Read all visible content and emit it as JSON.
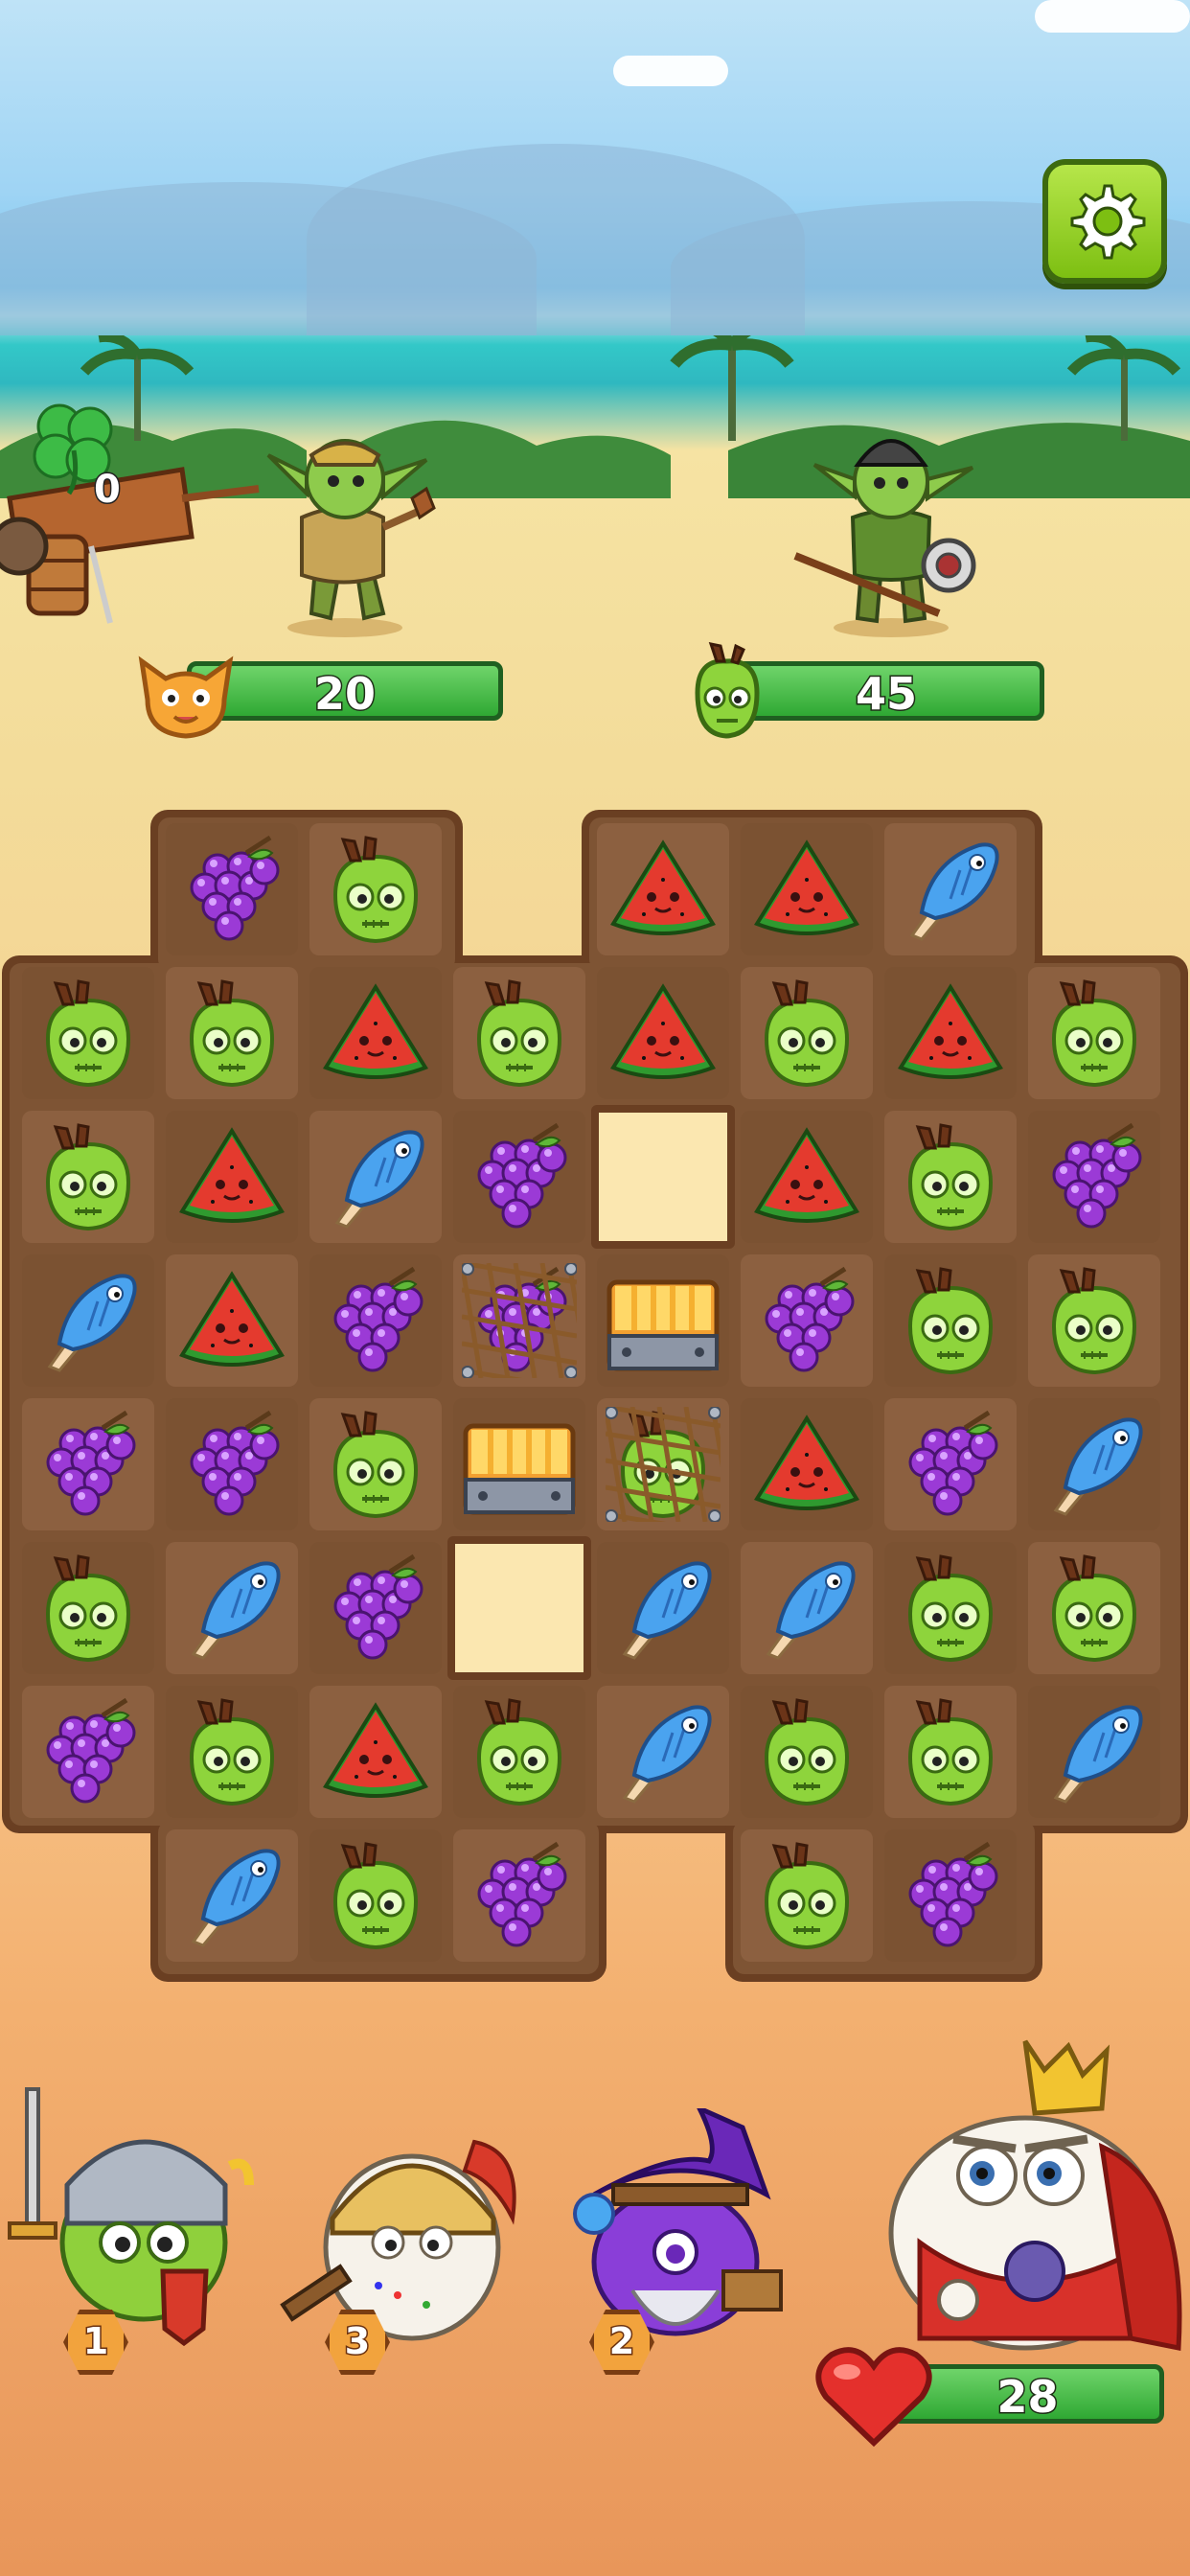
{
  "hud": {
    "clover_count": "0",
    "player_goal": {
      "icon": "orange-cat-icon",
      "count": "20"
    },
    "enemy_goal": {
      "icon": "green-lime-icon",
      "count": "45"
    },
    "settings_icon": "gear-icon",
    "lives": {
      "icon": "heart-icon",
      "count": "28"
    }
  },
  "heroes": [
    {
      "name": "knight-hero",
      "level": "1"
    },
    {
      "name": "warrior-egg-hero",
      "level": "3"
    },
    {
      "name": "wizard-hero",
      "level": "2"
    }
  ],
  "board": {
    "rows": [
      [
        "_",
        "grape",
        "lime",
        "_",
        "melon",
        "melon",
        "fish",
        "_"
      ],
      [
        "lime",
        "lime",
        "melon",
        "lime",
        "melon",
        "lime",
        "melon",
        "lime"
      ],
      [
        "lime",
        "melon",
        "fish",
        "grape",
        "empty",
        "melon",
        "lime",
        "grape"
      ],
      [
        "fish",
        "melon",
        "grape",
        "net-grape",
        "chest",
        "grape",
        "lime",
        "lime"
      ],
      [
        "grape",
        "grape",
        "lime",
        "chest",
        "net-lime",
        "melon",
        "grape",
        "fish"
      ],
      [
        "lime",
        "fish",
        "grape",
        "empty",
        "fish",
        "fish",
        "lime",
        "lime"
      ],
      [
        "grape",
        "lime",
        "melon",
        "lime",
        "fish",
        "lime",
        "lime",
        "fish"
      ],
      [
        "_",
        "fish",
        "lime",
        "grape",
        "_",
        "lime",
        "grape",
        "_"
      ]
    ]
  },
  "colors": {
    "tile_dark": "#7b5232",
    "tile_light": "#8c6040",
    "board_border": "#6a3f22",
    "bar_green": "#2fa833"
  }
}
